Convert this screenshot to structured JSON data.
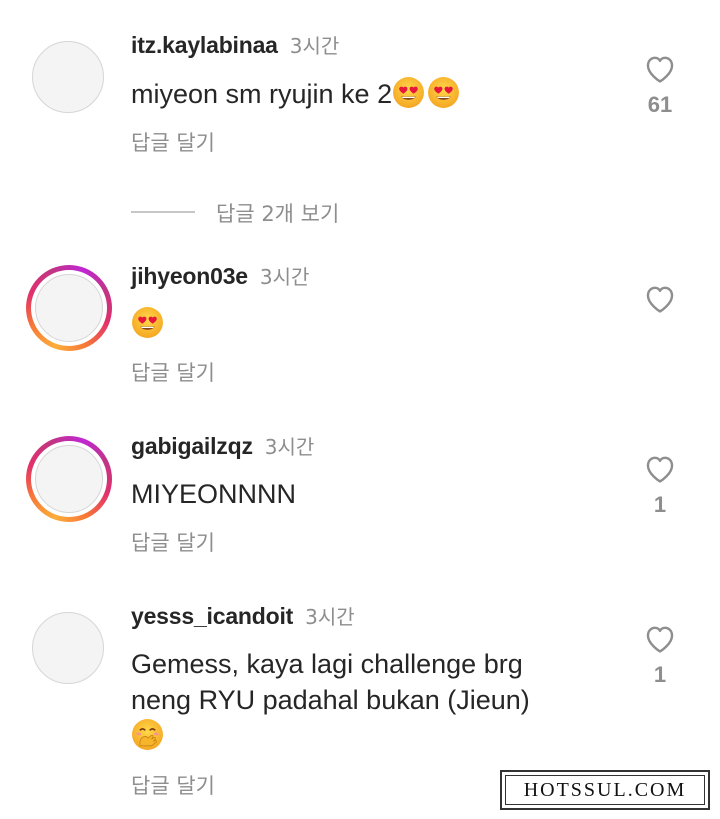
{
  "comments": [
    {
      "username": "itz.kaylabinaa",
      "time": "3시간",
      "text": "miyeon sm ryujin ke 2",
      "emojis": [
        "heart-eyes-emoji",
        "heart-eyes-emoji"
      ],
      "reply_label": "답글 달기",
      "likes": "61",
      "story_ring": false
    },
    {
      "username": "jihyeon03e",
      "time": "3시간",
      "text": "",
      "emojis": [
        "heart-eyes-emoji"
      ],
      "reply_label": "답글 달기",
      "likes": "",
      "story_ring": true
    },
    {
      "username": "gabigailzqz",
      "time": "3시간",
      "text": "MIYEONNNN",
      "emojis": [],
      "reply_label": "답글 달기",
      "likes": "1",
      "story_ring": true
    },
    {
      "username": "yesss_icandoit",
      "time": "3시간",
      "text_line1": "Gemess, kaya lagi challenge brg",
      "text_line2": "neng RYU padahal bukan (Jieun)",
      "emojis": [
        "hand-over-mouth-emoji"
      ],
      "reply_label": "답글 달기",
      "likes": "1",
      "story_ring": false
    }
  ],
  "view_replies_label": "답글 2개 보기",
  "watermark": "HOTSSUL.COM",
  "icons": {
    "like": "heart-outline-icon"
  },
  "colors": {
    "text": "#262626",
    "secondary": "#8e8e8e",
    "ring_start": "#fbae3a",
    "ring_end": "#c026d3"
  }
}
